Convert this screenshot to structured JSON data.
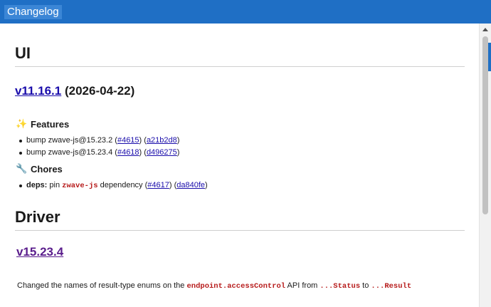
{
  "window": {
    "title": "Changelog"
  },
  "ui_section": {
    "heading": "UI",
    "version": {
      "link": "v11.16.1",
      "date": "(2026-04-22)"
    },
    "features": {
      "icon": "sparkles-icon",
      "label": "Features",
      "items": [
        {
          "text": "bump zwave-js@15.23.2 (",
          "pr": "#4615",
          "mid": ") (",
          "commit": "a21b2d8",
          "end": ")"
        },
        {
          "text": "bump zwave-js@15.23.4 (",
          "pr": "#4618",
          "mid": ") (",
          "commit": "d496275",
          "end": ")"
        }
      ]
    },
    "chores": {
      "icon": "wrench-icon",
      "label": "Chores",
      "items": [
        {
          "bold": "deps:",
          "pre": " pin ",
          "code": "zwave-js",
          "post": " dependency (",
          "pr": "#4617",
          "mid": ") (",
          "commit": "da840fe",
          "end": ")"
        }
      ]
    }
  },
  "driver_section": {
    "heading": "Driver",
    "version": {
      "link": "v15.23.4"
    },
    "paragraph": {
      "pre": "Changed the names of result-type enums on the ",
      "code1": "endpoint.accessControl",
      "mid": " API from ",
      "code2": "...Status",
      "to": " to ",
      "code3": "...Result"
    }
  },
  "colors": {
    "titlebar": "#1f6fc5",
    "link": "#1a0dab",
    "code": "#b71c1c"
  }
}
